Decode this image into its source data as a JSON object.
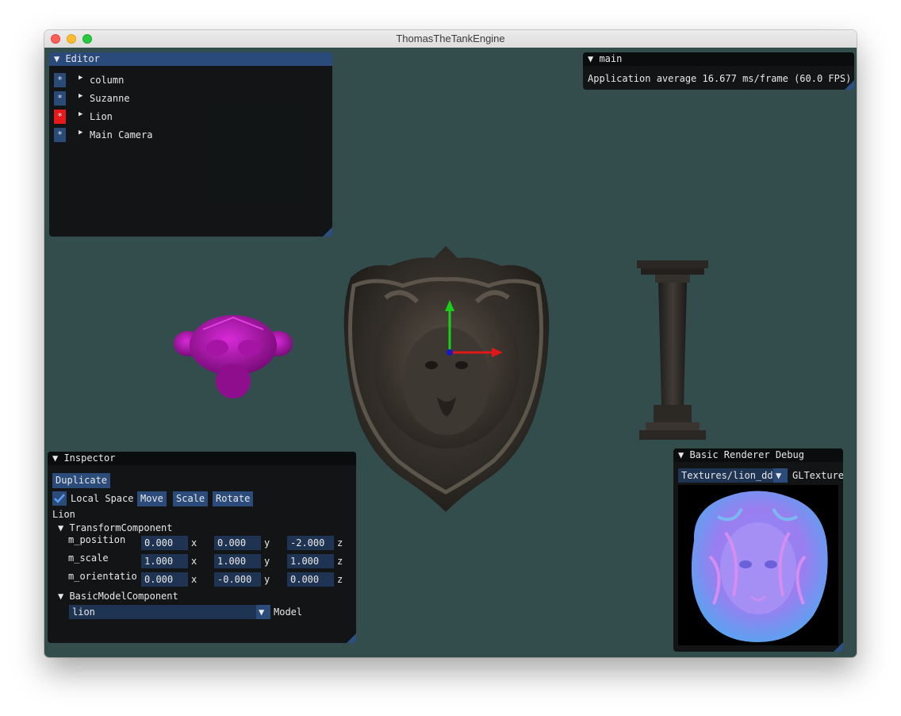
{
  "window": {
    "title": "ThomasTheTankEngine"
  },
  "editor": {
    "title": "▼ Editor",
    "items": [
      {
        "button": "*",
        "arrow": "▶",
        "label": "column",
        "selected": false
      },
      {
        "button": "*",
        "arrow": "▶",
        "label": "Suzanne",
        "selected": false
      },
      {
        "button": "*",
        "arrow": "▶",
        "label": "Lion",
        "selected": true
      },
      {
        "button": "*",
        "arrow": "▶",
        "label": "Main Camera",
        "selected": false
      }
    ]
  },
  "main_panel": {
    "title": "▼ main",
    "stats": "Application average 16.677 ms/frame (60.0 FPS)"
  },
  "inspector": {
    "title": "▼ Inspector",
    "duplicate": "Duplicate",
    "local_space": "Local Space",
    "local_space_checked": true,
    "move": "Move",
    "scale": "Scale",
    "rotate": "Rotate",
    "entity_name": "Lion",
    "transform_header": "▼ TransformComponent",
    "rows": [
      {
        "label": "m_position",
        "x": "0.000",
        "y": "0.000",
        "z": "-2.000"
      },
      {
        "label": "m_scale",
        "x": "1.000",
        "y": "1.000",
        "z": "1.000"
      },
      {
        "label": "m_orientatio",
        "x": "0.000",
        "y": "-0.000",
        "z": "0.000"
      }
    ],
    "axis_x": "x",
    "axis_y": "y",
    "axis_z": "z",
    "model_header": "▼ BasicModelComponent",
    "model_value": "lion",
    "model_arrow": "▼",
    "model_label": "Model"
  },
  "debug": {
    "title": "▼ Basic Renderer Debug",
    "texture_select": "Textures/lion_ddn",
    "select_arrow": "▼",
    "texture_type": "GLTexture"
  },
  "colors": {
    "viewport": "#334d4d",
    "active_title": "#294a7a",
    "button": "#2b4c7a",
    "selected_entity": "#e61a1a",
    "suzanne": "#c018c0"
  },
  "icons": {
    "close": "close-icon",
    "minimize": "minimize-icon",
    "zoom": "zoom-icon",
    "checkmark": "checkmark-icon",
    "collapse": "triangle-down-icon",
    "expand": "triangle-right-icon"
  }
}
